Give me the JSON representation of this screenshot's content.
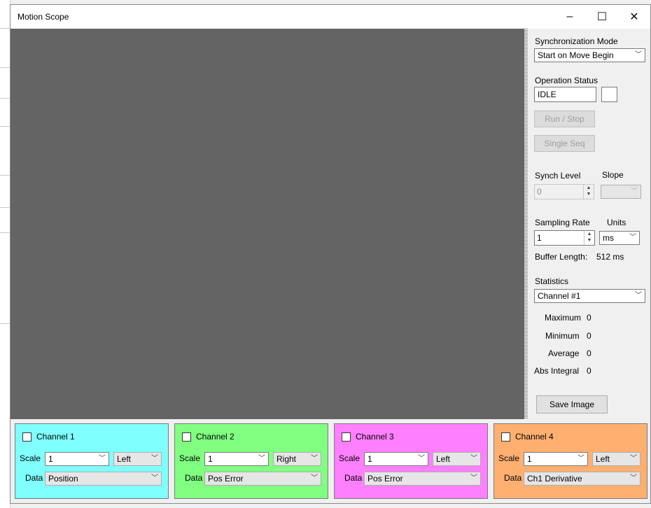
{
  "window": {
    "title": "Motion Scope",
    "minimize": "–",
    "maximize": "☐",
    "close": "✕"
  },
  "sync": {
    "label": "Synchronization Mode",
    "value": "Start on Move Begin"
  },
  "status": {
    "label": "Operation Status",
    "value": "IDLE"
  },
  "buttons": {
    "run_stop": "Run / Stop",
    "single_seq": "Single Seq",
    "save_image": "Save Image"
  },
  "synch_level": {
    "label": "Synch Level",
    "value": "0",
    "slope_label": "Slope",
    "slope_value": ""
  },
  "sampling": {
    "label": "Sampling Rate",
    "value": "1",
    "units_label": "Units",
    "units_value": "ms"
  },
  "buffer": {
    "label": "Buffer Length:",
    "value": "512 ms"
  },
  "statistics": {
    "label": "Statistics",
    "channel": "Channel #1",
    "maximum_label": "Maximum",
    "maximum": "0",
    "minimum_label": "Minimum",
    "minimum": "0",
    "average_label": "Average",
    "average": "0",
    "abs_integral_label": "Abs Integral",
    "abs_integral": "0"
  },
  "channels": [
    {
      "name": "Channel 1",
      "color": "#80ffff",
      "scale_label": "Scale",
      "scale": "1",
      "side": "Left",
      "data_label": "Data",
      "data": "Position"
    },
    {
      "name": "Channel 2",
      "color": "#80ff80",
      "scale_label": "Scale",
      "scale": "1",
      "side": "Right",
      "data_label": "Data",
      "data": "Pos Error"
    },
    {
      "name": "Channel 3",
      "color": "#ff80ff",
      "scale_label": "Scale",
      "scale": "1",
      "side": "Left",
      "data_label": "Data",
      "data": "Pos Error"
    },
    {
      "name": "Channel 4",
      "color": "#ffb070",
      "scale_label": "Scale",
      "scale": "1",
      "side": "Left",
      "data_label": "Data",
      "data": "Ch1 Derivative"
    }
  ],
  "icons": {
    "dropdown": "chevron-down-icon",
    "spin": "spin-arrows-icon"
  }
}
